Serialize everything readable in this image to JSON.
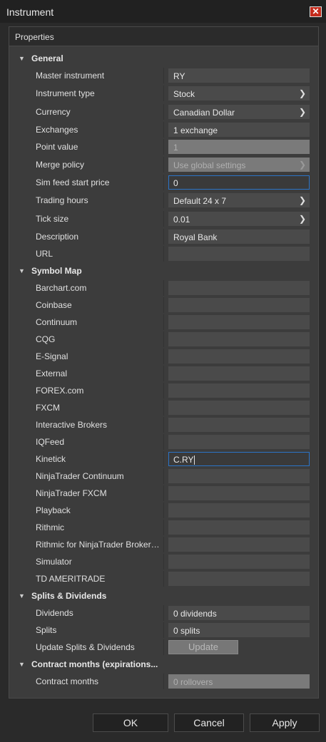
{
  "window": {
    "title": "Instrument",
    "close_icon": "close-icon"
  },
  "panel": {
    "header": "Properties"
  },
  "sections": {
    "general": "General",
    "symbol_map": "Symbol Map",
    "splits": "Splits & Dividends",
    "contract": "Contract months (expirations..."
  },
  "general": {
    "master_instrument": {
      "label": "Master instrument",
      "value": "RY"
    },
    "instrument_type": {
      "label": "Instrument type",
      "value": "Stock"
    },
    "currency": {
      "label": "Currency",
      "value": "Canadian Dollar"
    },
    "exchanges": {
      "label": "Exchanges",
      "value": "1 exchange"
    },
    "point_value": {
      "label": "Point value",
      "value": "1"
    },
    "merge_policy": {
      "label": "Merge policy",
      "value": "Use global settings"
    },
    "sim_feed": {
      "label": "Sim feed start price",
      "value": "0"
    },
    "trading_hours": {
      "label": "Trading hours",
      "value": "Default 24 x 7"
    },
    "tick_size": {
      "label": "Tick size",
      "value": "0.01"
    },
    "description": {
      "label": "Description",
      "value": "Royal Bank"
    },
    "url": {
      "label": "URL",
      "value": ""
    }
  },
  "symbol_map": [
    {
      "label": "Barchart.com",
      "value": ""
    },
    {
      "label": "Coinbase",
      "value": ""
    },
    {
      "label": "Continuum",
      "value": ""
    },
    {
      "label": "CQG",
      "value": ""
    },
    {
      "label": "E-Signal",
      "value": ""
    },
    {
      "label": "External",
      "value": ""
    },
    {
      "label": "FOREX.com",
      "value": ""
    },
    {
      "label": "FXCM",
      "value": ""
    },
    {
      "label": "Interactive Brokers",
      "value": ""
    },
    {
      "label": "IQFeed",
      "value": ""
    },
    {
      "label": "Kinetick",
      "value": "C.RY"
    },
    {
      "label": "NinjaTrader Continuum",
      "value": ""
    },
    {
      "label": "NinjaTrader FXCM",
      "value": ""
    },
    {
      "label": "Playback",
      "value": ""
    },
    {
      "label": "Rithmic",
      "value": ""
    },
    {
      "label": "Rithmic for NinjaTrader Brokerage",
      "value": ""
    },
    {
      "label": "Simulator",
      "value": ""
    },
    {
      "label": "TD AMERITRADE",
      "value": ""
    }
  ],
  "splits": {
    "dividends": {
      "label": "Dividends",
      "value": "0 dividends"
    },
    "splits": {
      "label": "Splits",
      "value": "0 splits"
    },
    "update": {
      "label": "Update Splits & Dividends",
      "button": "Update"
    }
  },
  "contract": {
    "label": "Contract months",
    "value": "0 rollovers"
  },
  "footer": {
    "ok": "OK",
    "cancel": "Cancel",
    "apply": "Apply"
  },
  "colors": {
    "accent": "#2b74c7",
    "close": "#c42b1c",
    "panel": "#3c3c3c",
    "field": "#4a4a4a"
  }
}
